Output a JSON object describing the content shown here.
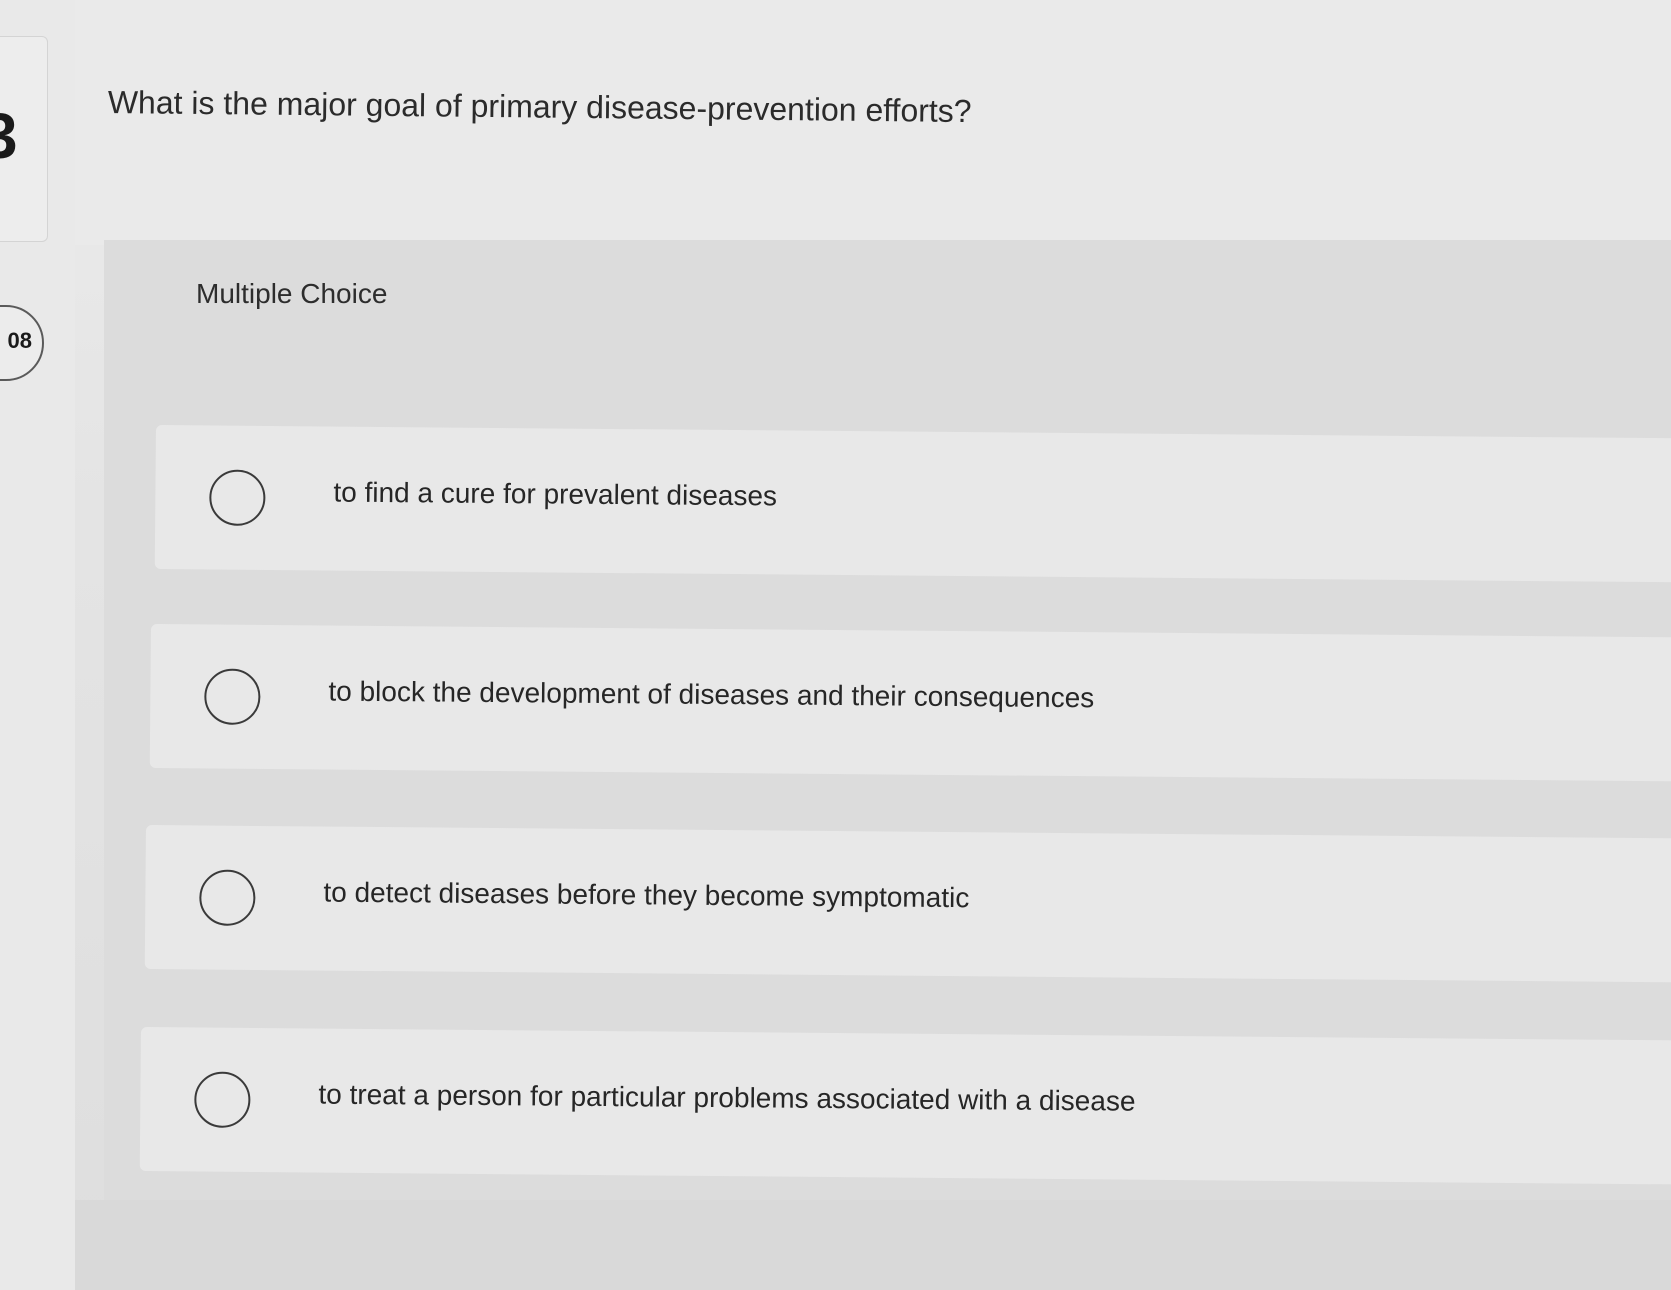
{
  "sidebar": {
    "question_number": "08"
  },
  "question": {
    "text": "What is the major goal of primary disease-prevention efforts?",
    "type_label": "Multiple Choice"
  },
  "options": [
    {
      "label": "to find a cure for prevalent diseases"
    },
    {
      "label": "to block the development of diseases and their consequences"
    },
    {
      "label": "to detect diseases before they become symptomatic"
    },
    {
      "label": "to treat a person for particular problems associated with a disease"
    }
  ]
}
